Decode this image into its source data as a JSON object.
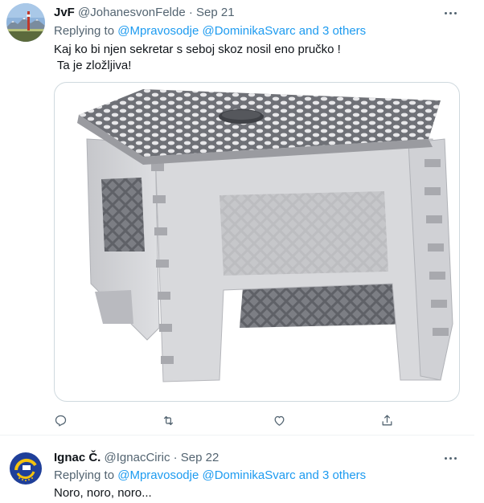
{
  "tweets": [
    {
      "name": "JvF",
      "handle": "@JohanesvonFelde",
      "separator": "·",
      "date": "Sep 21",
      "replying_prefix": "Replying to",
      "mentions": [
        "@Mpravosodje",
        "@DominikaSvarc",
        "and 3 others"
      ],
      "text_lines": [
        "Kaj ko bi njen sekretar s seboj skoz nosil eno pručko !",
        " Ta je zložljiva!"
      ],
      "media": "image of a grey folding step stool",
      "actions": [
        "reply-icon",
        "retweet-icon",
        "like-icon",
        "share-icon"
      ]
    },
    {
      "name": "Ignac Č.",
      "handle": "@IgnacCiric",
      "separator": "·",
      "date": "Sep 22",
      "replying_prefix": "Replying to",
      "mentions": [
        "@Mpravosodje",
        "@DominikaSvarc",
        "and 3 others"
      ],
      "text_lines": [
        "Noro, noro, noro..."
      ]
    }
  ],
  "colors": {
    "accent": "#1d9bf0",
    "text": "#0f1419",
    "secondary": "#536471",
    "border": "#cfd9de"
  }
}
